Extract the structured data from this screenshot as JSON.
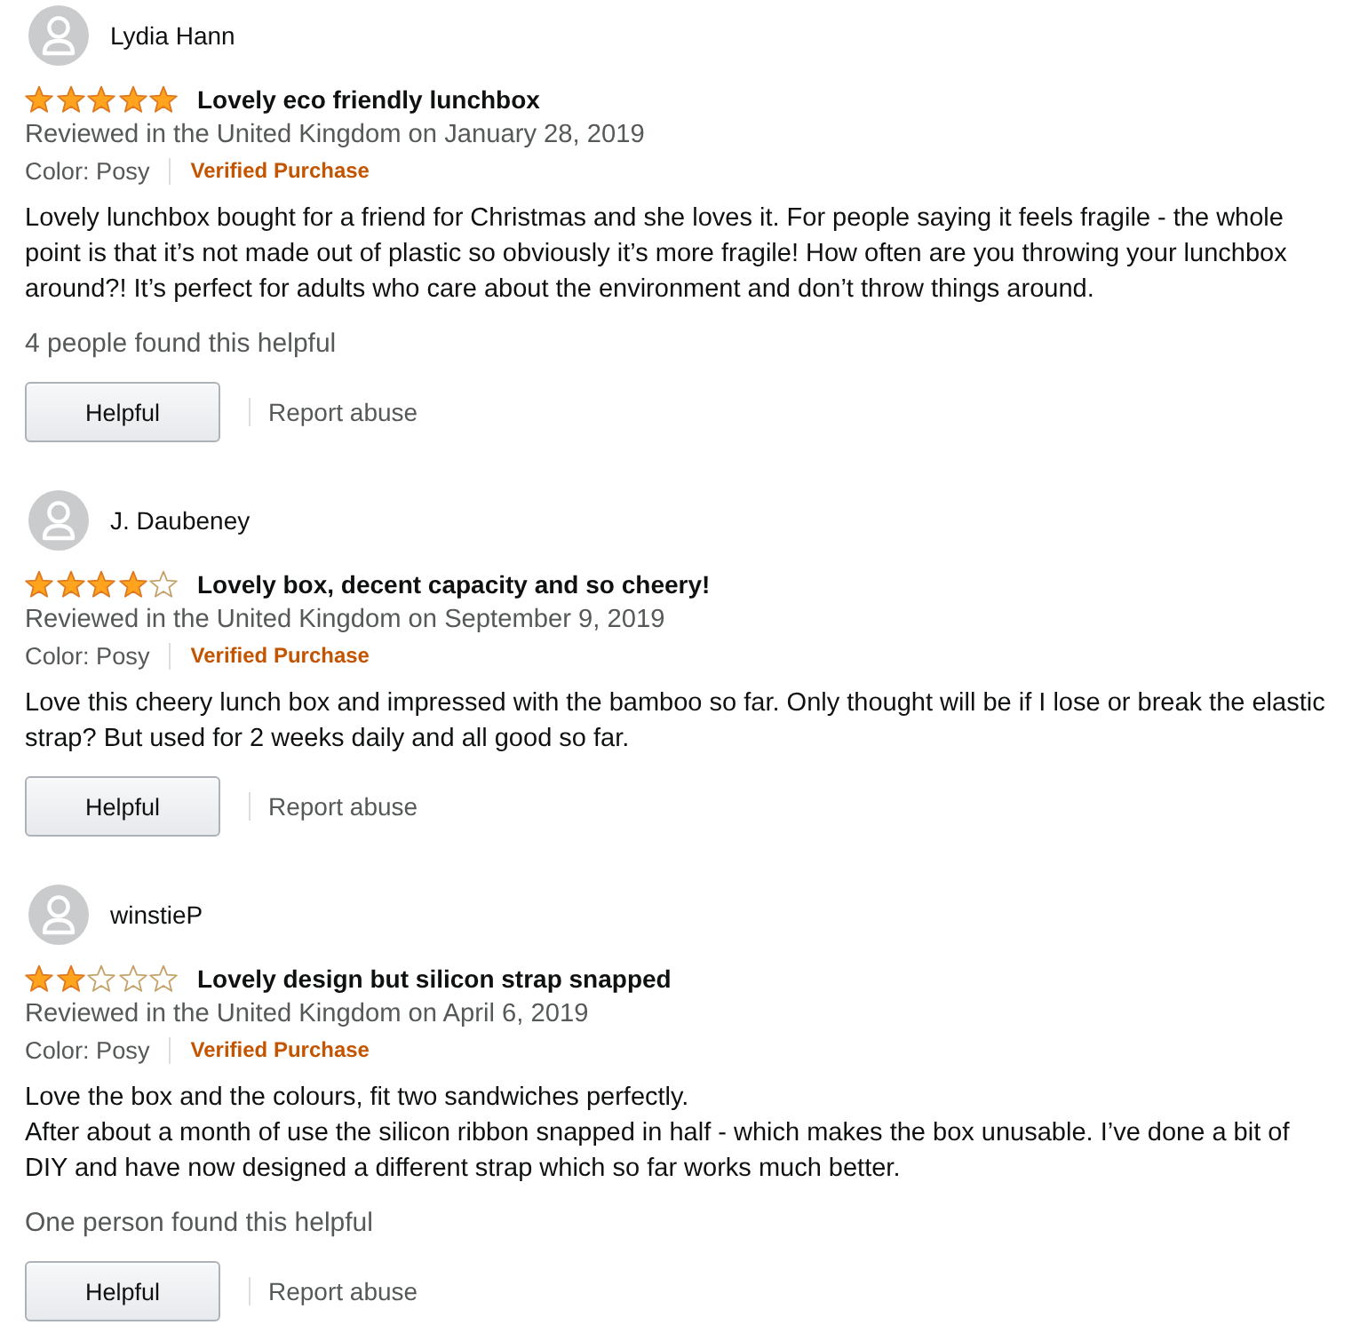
{
  "reviews": [
    {
      "author": "Lydia Hann",
      "stars": 5,
      "title": "Lovely eco friendly lunchbox",
      "date": "Reviewed in the United Kingdom on January 28, 2019",
      "variant": "Color: Posy",
      "badge": "Verified Purchase",
      "body": [
        "Lovely lunchbox bought for a friend for Christmas and she loves it. For people saying it feels fragile - the whole point is that it’s not made out of plastic so obviously it’s more fragile! How often are you throwing your lunchbox around?! It’s perfect for adults who care about the environment and don’t throw things around."
      ],
      "helpful_count": "4 people found this helpful",
      "helpful_button": "Helpful",
      "report_link": "Report abuse"
    },
    {
      "author": "J. Daubeney",
      "stars": 4,
      "title": "Lovely box, decent capacity and so cheery!",
      "date": "Reviewed in the United Kingdom on September 9, 2019",
      "variant": "Color: Posy",
      "badge": "Verified Purchase",
      "body": [
        "Love this cheery lunch box and impressed with the bamboo so far. Only thought will be if I lose or break the elastic strap? But used for 2 weeks daily and all good so far."
      ],
      "helpful_button": "Helpful",
      "report_link": "Report abuse"
    },
    {
      "author": "winstieP",
      "stars": 2,
      "title": "Lovely design but silicon strap snapped",
      "date": "Reviewed in the United Kingdom on April 6, 2019",
      "variant": "Color: Posy",
      "badge": "Verified Purchase",
      "body": [
        "Love the box and the colours, fit two sandwiches perfectly.",
        "After about a month of use the silicon ribbon snapped in half - which makes the box unusable. I’ve done a bit of DIY and have now designed a different strap which so far works much better."
      ],
      "helpful_count": "One person found this helpful",
      "helpful_button": "Helpful",
      "report_link": "Report abuse"
    }
  ]
}
